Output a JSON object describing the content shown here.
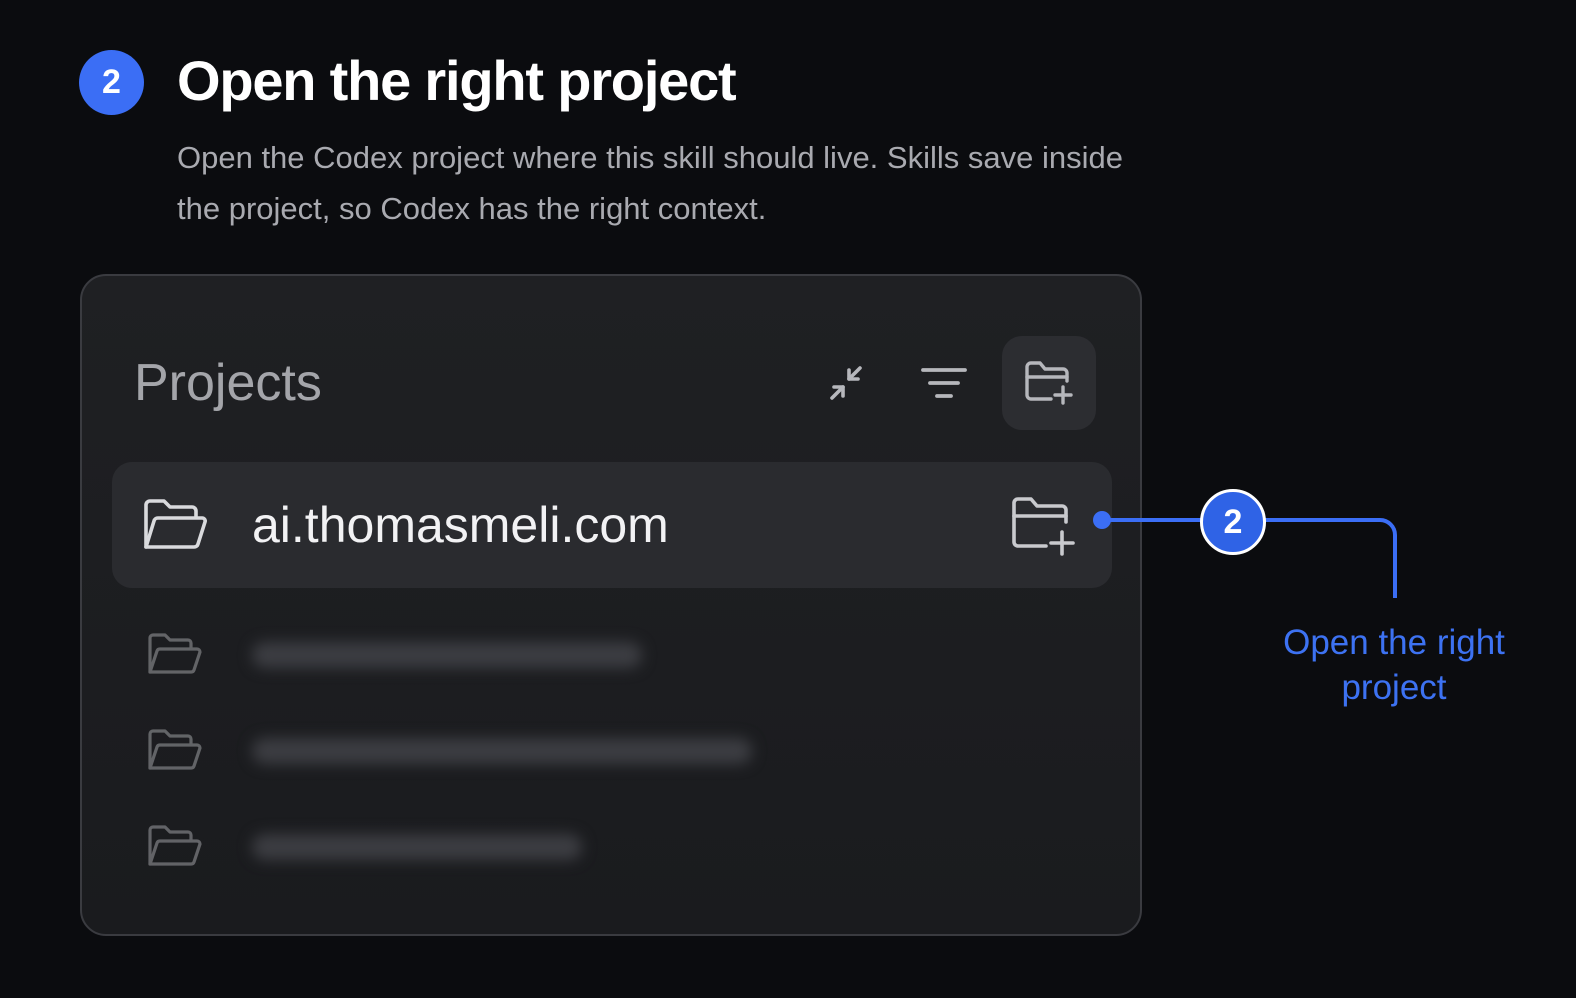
{
  "step": {
    "number": "2",
    "title": "Open the right project",
    "description": "Open the Codex project where this skill should live. Skills save inside the project, so Codex has the right context."
  },
  "panel": {
    "title": "Projects",
    "toolbar": {
      "collapse_icon": "collapse-arrows-icon",
      "filter_icon": "filter-icon",
      "new_project_icon": "folder-plus-icon"
    },
    "selected_project": {
      "name": "ai.thomasmeli.com",
      "folder_icon": "folder-open-icon",
      "action_icon": "folder-plus-icon"
    },
    "blurred_projects_count": 3
  },
  "callout": {
    "number": "2",
    "label": "Open the right project"
  },
  "colors": {
    "background": "#0b0c0f",
    "accent": "#3b6ef5",
    "callout_text": "#3d72f2",
    "panel": "#1d1e21",
    "selected_row": "#2a2b2f"
  }
}
